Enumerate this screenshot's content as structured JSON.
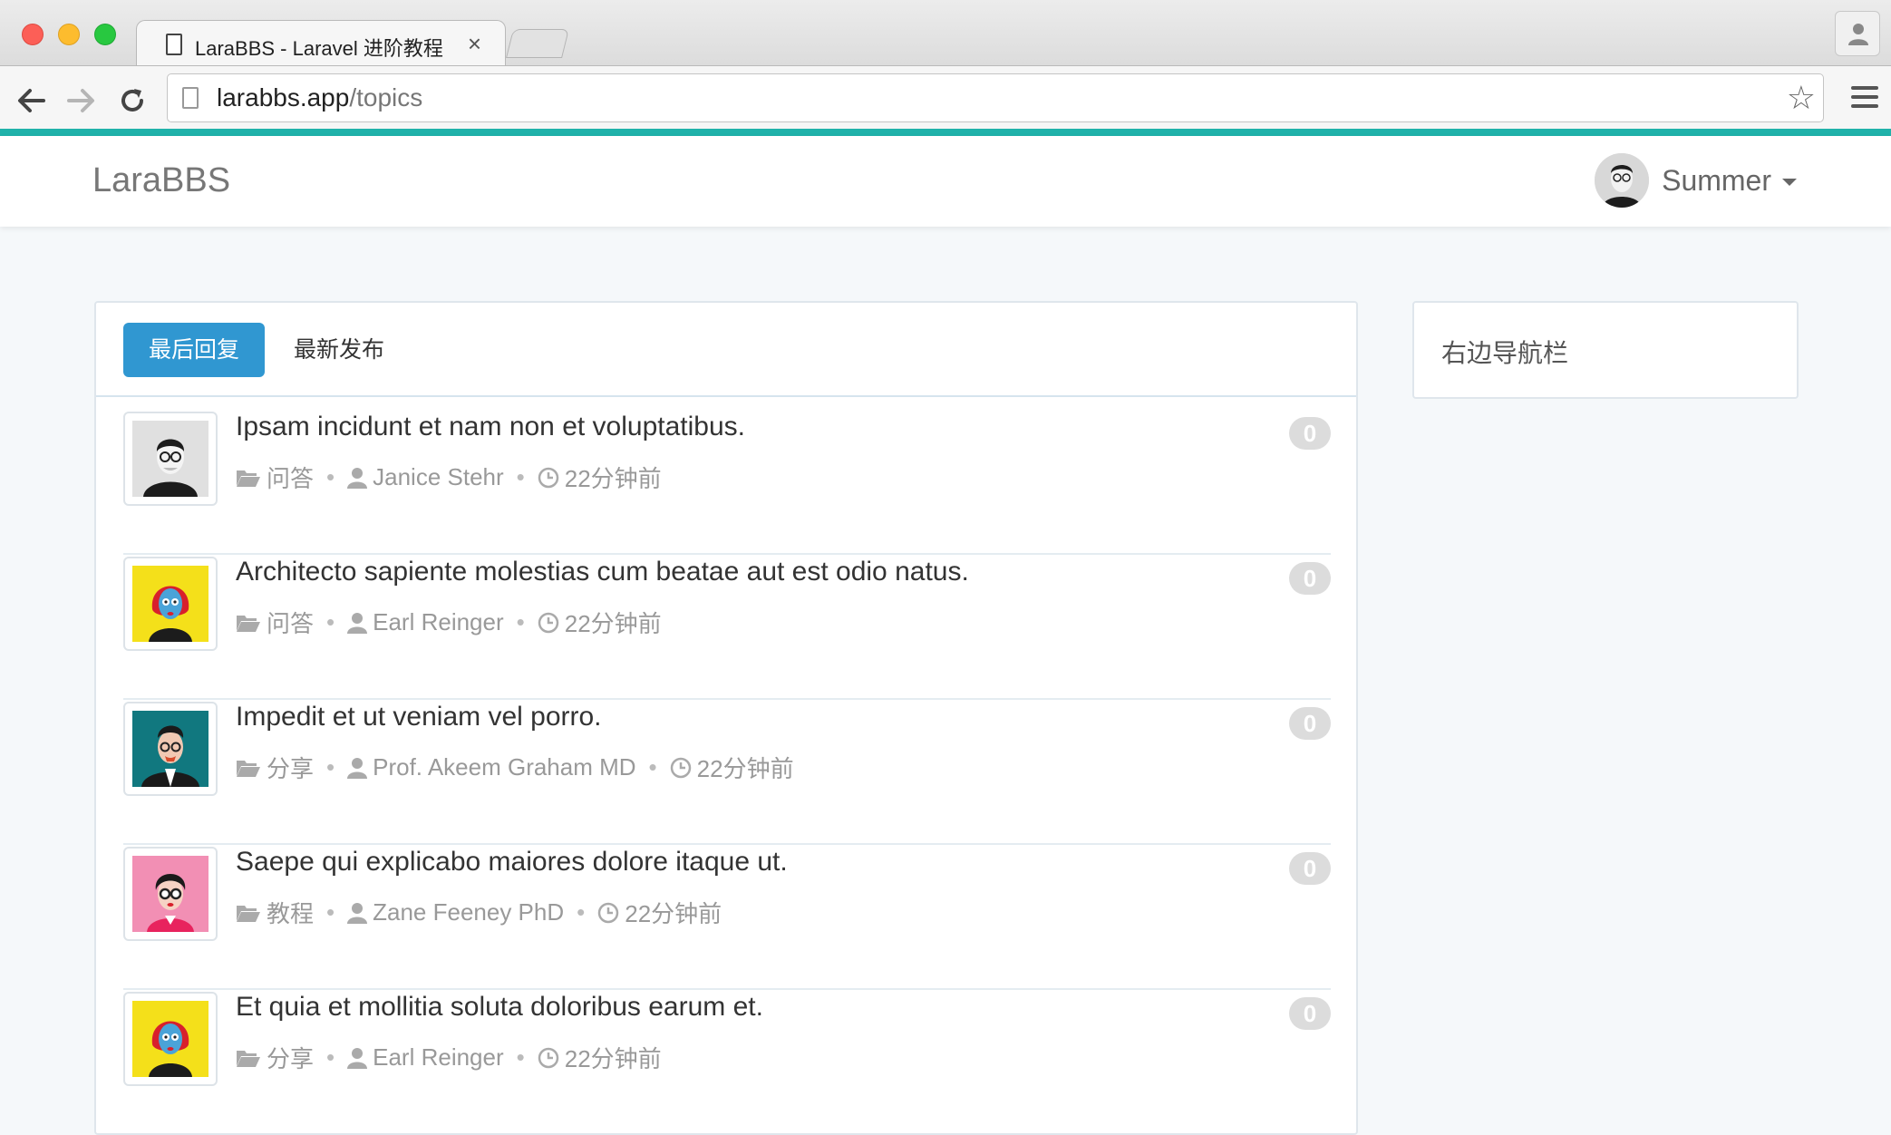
{
  "browser": {
    "tab_title": "LaraBBS - Laravel 进阶教程",
    "tab_close": "×",
    "url_host": "larabbs.app",
    "url_path": "/topics",
    "star_icon": "☆"
  },
  "site": {
    "brand": "LaraBBS",
    "user_name": "Summer",
    "accent_color": "#20b2aa",
    "primary_color": "#3097d1"
  },
  "tabs": {
    "last_reply": "最后回复",
    "newest": "最新发布"
  },
  "topics": [
    {
      "title": "Ipsam incidunt et nam non et voluptatibus.",
      "category": "问答",
      "author": "Janice Stehr",
      "time": "22分钟前",
      "replies": "0",
      "avatar_bg": "#e0e0e0",
      "avatar_icon": "avatar-man-glasses"
    },
    {
      "title": "Architecto sapiente molestias cum beatae aut est odio natus.",
      "category": "问答",
      "author": "Earl Reinger",
      "time": "22分钟前",
      "replies": "0",
      "avatar_bg": "#f4e01a",
      "avatar_icon": "avatar-woman-red-hair"
    },
    {
      "title": "Impedit et ut veniam vel porro.",
      "category": "分享",
      "author": "Prof. Akeem Graham MD",
      "time": "22分钟前",
      "replies": "0",
      "avatar_bg": "#11787f",
      "avatar_icon": "avatar-man-suit"
    },
    {
      "title": "Saepe qui explicabo maiores dolore itaque ut.",
      "category": "教程",
      "author": "Zane Feeney PhD",
      "time": "22分钟前",
      "replies": "0",
      "avatar_bg": "#f28fb4",
      "avatar_icon": "avatar-woman-glasses"
    },
    {
      "title": "Et quia et mollitia soluta doloribus earum et.",
      "category": "分享",
      "author": "Earl Reinger",
      "time": "22分钟前",
      "replies": "0",
      "avatar_bg": "#f4e01a",
      "avatar_icon": "avatar-woman-red-hair"
    }
  ],
  "sidebar": {
    "title": "右边导航栏"
  }
}
